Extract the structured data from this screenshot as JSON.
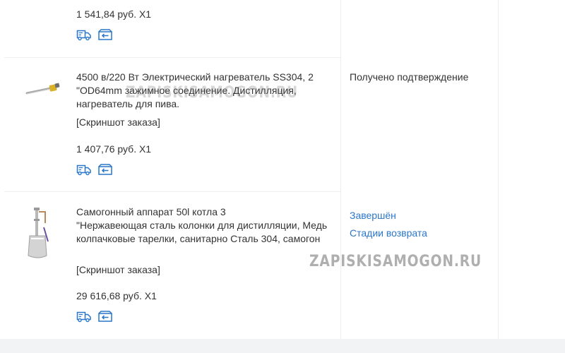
{
  "orders": [
    {
      "title": "",
      "snapshot_link": "",
      "price": "1 541,84 руб. X1",
      "status": null,
      "icons": [
        "delivery-truck-icon",
        "return-arrow-icon"
      ]
    },
    {
      "title": "4500 в/220 Вт Электрический нагреватель SS304, 2 \"OD64mm зажимное соединение. Дистилляция, нагреватель для пива.",
      "snapshot_link": "[Скриншот заказа]",
      "price": "1 407,76 руб. X1",
      "status": "Получено подтверждение",
      "icons": [
        "delivery-truck-icon",
        "return-arrow-icon"
      ]
    },
    {
      "title": "Самогонный аппарат 50l котла 3\n\"Нержавеющая сталь колонки для дистилляции, Медь колпачковые тарелки, санитарно Сталь 304, самогон",
      "snapshot_link": "[Скриншот заказа]",
      "price": "29 616,68 руб. X1",
      "status_links": [
        "Завершён",
        "Стадии возврата"
      ],
      "icons": [
        "delivery-truck-icon",
        "return-arrow-icon"
      ]
    }
  ],
  "watermark": "ZAPISKISAMOGON.RU",
  "colors": {
    "link": "#2a77c9",
    "icon": "#2a77c9",
    "text": "#333333",
    "divider": "#eeeeee",
    "footer_band": "#f2f3f5"
  }
}
